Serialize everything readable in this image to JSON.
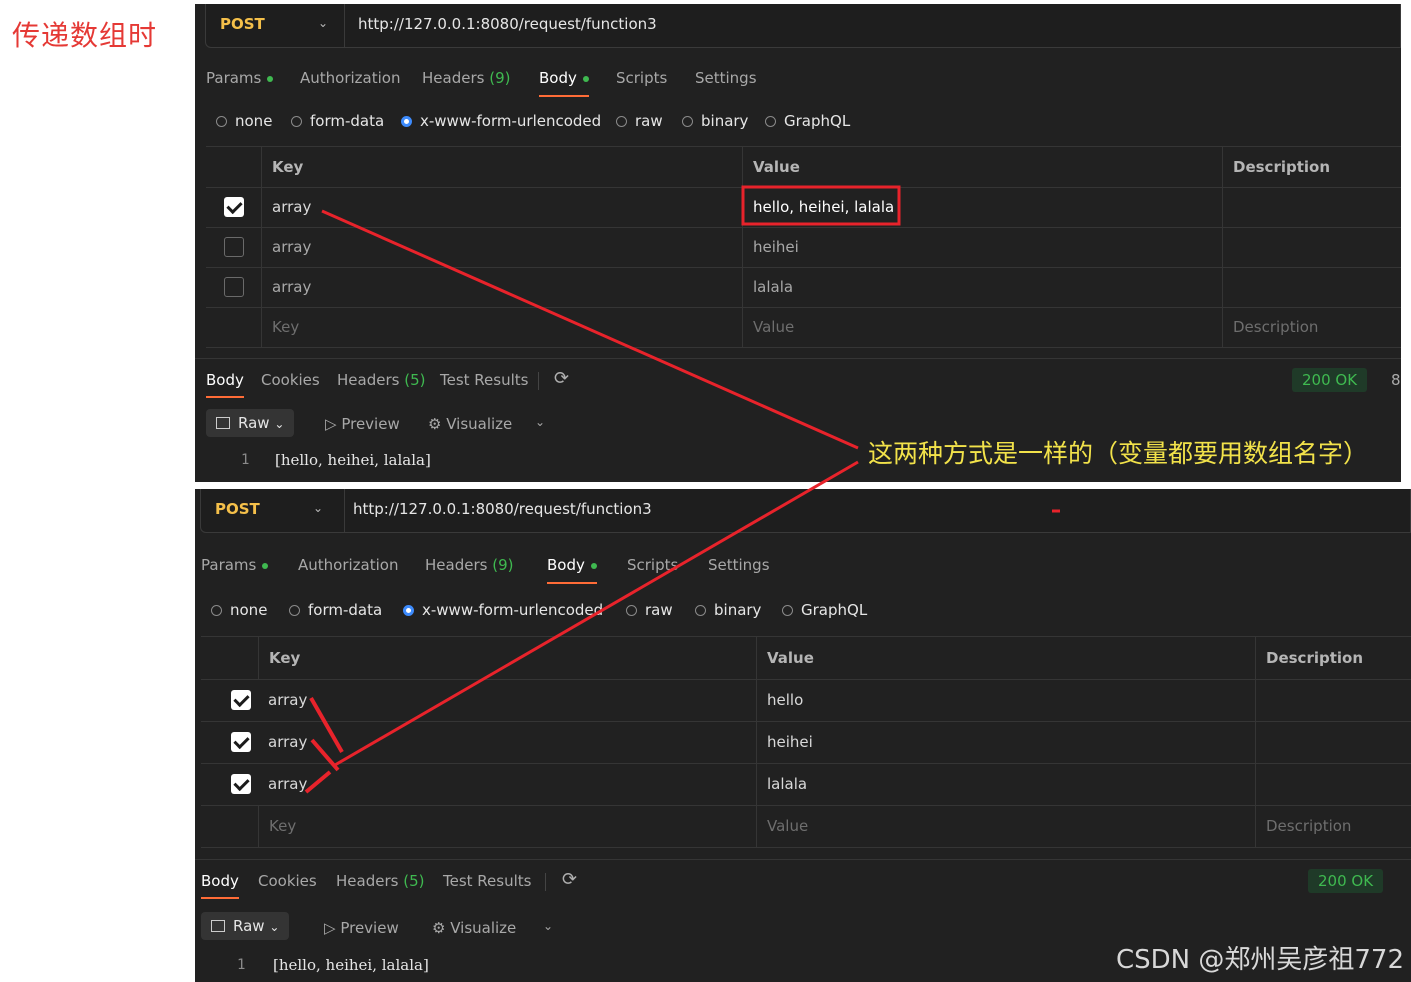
{
  "side_title": "传递数组时",
  "annotation": "这两种方式是一样的（变量都要用数组名字）",
  "watermark": "CSDN @郑州吴彦祖772",
  "colors": {
    "annotation_red": "#e8232b",
    "annotation_yellow": "#f2e24a",
    "accent": "#ff6c37",
    "ok_green": "#3fb950"
  },
  "panels": [
    {
      "method": "POST",
      "url": "http://127.0.0.1:8080/request/function3",
      "tabs": {
        "params": "Params",
        "authorization": "Authorization",
        "headers": "Headers",
        "headers_count": "(9)",
        "body": "Body",
        "scripts": "Scripts",
        "settings": "Settings"
      },
      "body_types": {
        "none": "none",
        "form_data": "form-data",
        "urlencoded": "x-www-form-urlencoded",
        "raw": "raw",
        "binary": "binary",
        "graphql": "GraphQL"
      },
      "table": {
        "headers": {
          "key": "Key",
          "value": "Value",
          "description": "Description"
        },
        "rows": [
          {
            "key": "array",
            "value": "hello, heihei, lalala",
            "checked": true
          },
          {
            "key": "array",
            "value": "heihei",
            "checked": false
          },
          {
            "key": "array",
            "value": "lalala",
            "checked": false
          }
        ],
        "placeholder": {
          "key": "Key",
          "value": "Value",
          "description": "Description"
        }
      },
      "response_tabs": {
        "body": "Body",
        "cookies": "Cookies",
        "headers": "Headers",
        "headers_count": "(5)",
        "test_results": "Test Results"
      },
      "status": "200 OK",
      "status_tail": "8",
      "view": {
        "raw": "Raw",
        "preview": "Preview",
        "visualize": "Visualize"
      },
      "code": {
        "line": "1",
        "text": "[hello, heihei, lalala]"
      }
    },
    {
      "method": "POST",
      "url": "http://127.0.0.1:8080/request/function3",
      "tabs": {
        "params": "Params",
        "authorization": "Authorization",
        "headers": "Headers",
        "headers_count": "(9)",
        "body": "Body",
        "scripts": "Scripts",
        "settings": "Settings"
      },
      "body_types": {
        "none": "none",
        "form_data": "form-data",
        "urlencoded": "x-www-form-urlencoded",
        "raw": "raw",
        "binary": "binary",
        "graphql": "GraphQL"
      },
      "table": {
        "headers": {
          "key": "Key",
          "value": "Value",
          "description": "Description"
        },
        "rows": [
          {
            "key": "array",
            "value": "hello",
            "checked": true
          },
          {
            "key": "array",
            "value": "heihei",
            "checked": true
          },
          {
            "key": "array",
            "value": "lalala",
            "checked": true
          }
        ],
        "placeholder": {
          "key": "Key",
          "value": "Value",
          "description": "Description"
        }
      },
      "response_tabs": {
        "body": "Body",
        "cookies": "Cookies",
        "headers": "Headers",
        "headers_count": "(5)",
        "test_results": "Test Results"
      },
      "status": "200 OK",
      "view": {
        "raw": "Raw",
        "preview": "Preview",
        "visualize": "Visualize"
      },
      "code": {
        "line": "1",
        "text": "[hello, heihei, lalala]"
      }
    }
  ]
}
